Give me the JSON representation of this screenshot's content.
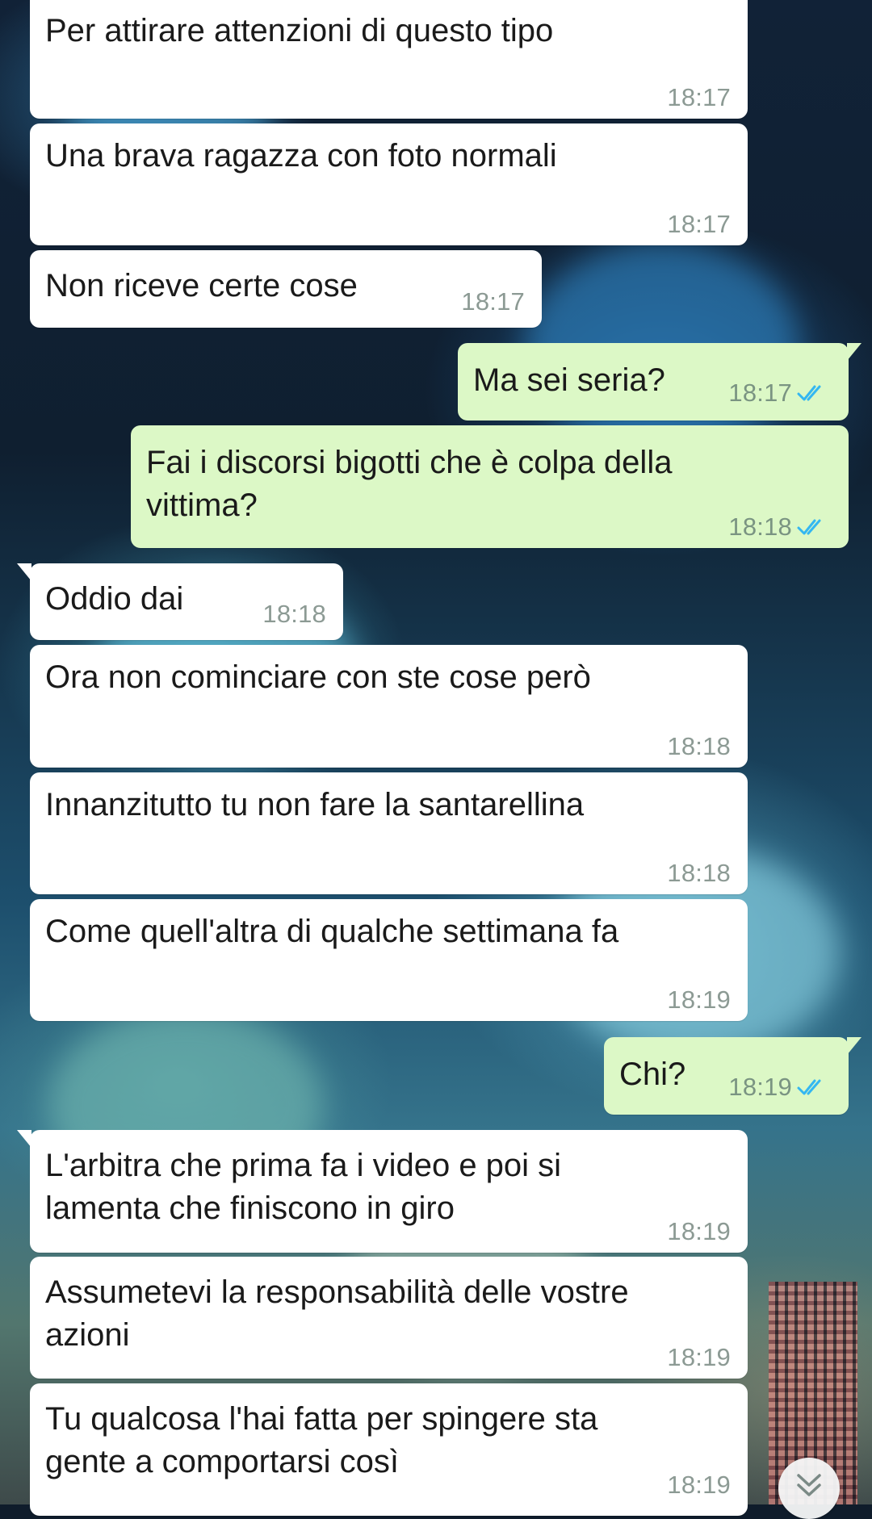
{
  "colors": {
    "incoming_bubble": "#ffffff",
    "outgoing_bubble": "#dcf8c6",
    "timestamp": "#8c9a94",
    "read_ticks": "#34b7f1"
  },
  "messages": [
    {
      "direction": "in",
      "text": [
        "Per attirare attenzioni di questo tipo"
      ],
      "time": "18:17"
    },
    {
      "direction": "in",
      "text": [
        "Una brava ragazza con foto normali"
      ],
      "time": "18:17"
    },
    {
      "direction": "in",
      "text": [
        "Non riceve certe cose"
      ],
      "time": "18:17"
    },
    {
      "direction": "out",
      "text": [
        "Ma sei seria?"
      ],
      "time": "18:17",
      "status": "read"
    },
    {
      "direction": "out",
      "text": [
        "Fai i discorsi bigotti che è colpa della",
        "vittima?"
      ],
      "time": "18:18",
      "status": "read"
    },
    {
      "direction": "in",
      "text": [
        "Oddio dai"
      ],
      "time": "18:18"
    },
    {
      "direction": "in",
      "text": [
        "Ora non cominciare con ste cose però"
      ],
      "time": "18:18"
    },
    {
      "direction": "in",
      "text": [
        "Innanzitutto tu non fare la santarellina"
      ],
      "time": "18:18"
    },
    {
      "direction": "in",
      "text": [
        "Come quell'altra di qualche settimana fa"
      ],
      "time": "18:19"
    },
    {
      "direction": "out",
      "text": [
        "Chi?"
      ],
      "time": "18:19",
      "status": "read"
    },
    {
      "direction": "in",
      "text": [
        "L'arbitra che prima fa i video e poi si",
        "lamenta che finiscono in giro"
      ],
      "time": "18:19"
    },
    {
      "direction": "in",
      "text": [
        "Assumetevi la responsabilità delle vostre",
        "azioni"
      ],
      "time": "18:19"
    },
    {
      "direction": "in",
      "text": [
        "Tu qualcosa l'hai fatta per spingere sta",
        "gente a comportarsi così"
      ],
      "time": "18:19"
    }
  ],
  "scroll_button": {
    "icon": "double-chevron-down-icon"
  }
}
